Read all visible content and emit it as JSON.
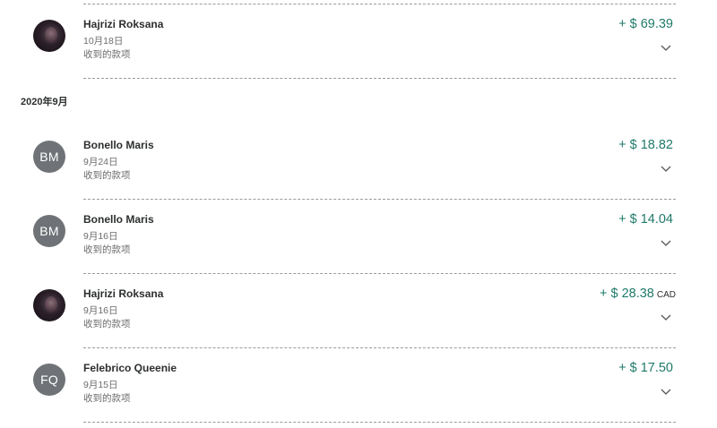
{
  "month_header": "2020年9月",
  "colors": {
    "positive_amount": "#1f7a6a",
    "avatar_gray": "#6f7377"
  },
  "transactions": [
    {
      "name": "Hajrizi Roksana",
      "date": "10月18日",
      "description": "收到的款项",
      "amount": "+ $ 69.39",
      "currency": "",
      "avatar_type": "photo",
      "initials": ""
    },
    {
      "name": "Bonello Maris",
      "date": "9月24日",
      "description": "收到的款项",
      "amount": "+ $ 18.82",
      "currency": "",
      "avatar_type": "initials",
      "initials": "BM"
    },
    {
      "name": "Bonello Maris",
      "date": "9月16日",
      "description": "收到的款项",
      "amount": "+ $ 14.04",
      "currency": "",
      "avatar_type": "initials",
      "initials": "BM"
    },
    {
      "name": "Hajrizi Roksana",
      "date": "9月16日",
      "description": "收到的款项",
      "amount": "+ $ 28.38",
      "currency": "CAD",
      "avatar_type": "photo",
      "initials": ""
    },
    {
      "name": "Felebrico Queenie",
      "date": "9月15日",
      "description": "收到的款项",
      "amount": "+ $ 17.50",
      "currency": "",
      "avatar_type": "initials",
      "initials": "FQ"
    }
  ],
  "icons": {
    "expand": "chevron-down-icon"
  }
}
